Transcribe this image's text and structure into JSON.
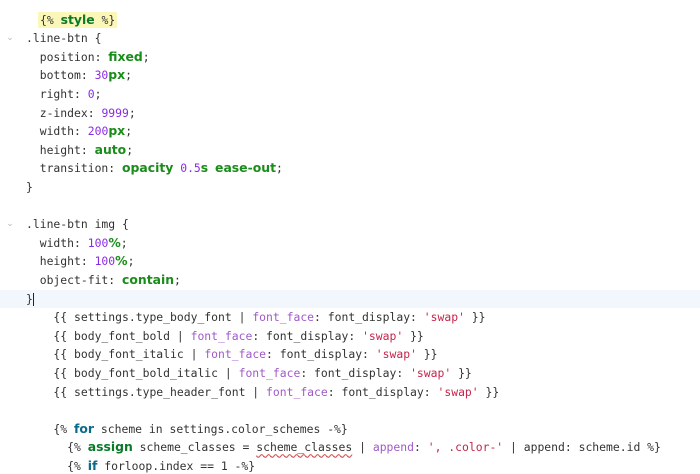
{
  "colors": {
    "background": "#ffffff",
    "active_line": "#f1f7fd",
    "value_green": "#1a8c1a",
    "number_purple": "#8a2be2",
    "string_red": "#c4254a",
    "filter_purple": "#a05ac8",
    "keyword_blue": "#0a6a8a",
    "style_highlight": "#fbf7b8"
  },
  "lines": [
    {
      "fold": "",
      "tokens": [
        {
          "t": "{% ",
          "c": "k-liquid-tag hl"
        },
        {
          "t": "style",
          "c": "k-liquid-kw2 hl"
        },
        {
          "t": " %}",
          "c": "k-liquid-tag hl"
        }
      ]
    },
    {
      "fold": "⌄",
      "tokens": [
        {
          "t": ".line-btn {",
          "c": "k-sel"
        }
      ]
    },
    {
      "fold": "",
      "tokens": [
        {
          "t": "  position: ",
          "c": "k-prop"
        },
        {
          "t": "fixed",
          "c": "k-val"
        },
        {
          "t": ";",
          "c": "k-punct"
        }
      ]
    },
    {
      "fold": "",
      "tokens": [
        {
          "t": "  bottom: ",
          "c": "k-prop"
        },
        {
          "t": "30",
          "c": "k-num"
        },
        {
          "t": "px",
          "c": "k-unit"
        },
        {
          "t": ";",
          "c": "k-punct"
        }
      ]
    },
    {
      "fold": "",
      "tokens": [
        {
          "t": "  right: ",
          "c": "k-prop"
        },
        {
          "t": "0",
          "c": "k-num"
        },
        {
          "t": ";",
          "c": "k-punct"
        }
      ]
    },
    {
      "fold": "",
      "tokens": [
        {
          "t": "  z-index: ",
          "c": "k-prop"
        },
        {
          "t": "9999",
          "c": "k-num"
        },
        {
          "t": ";",
          "c": "k-punct"
        }
      ]
    },
    {
      "fold": "",
      "tokens": [
        {
          "t": "  width: ",
          "c": "k-prop"
        },
        {
          "t": "200",
          "c": "k-num"
        },
        {
          "t": "px",
          "c": "k-unit"
        },
        {
          "t": ";",
          "c": "k-punct"
        }
      ]
    },
    {
      "fold": "",
      "tokens": [
        {
          "t": "  height: ",
          "c": "k-prop"
        },
        {
          "t": "auto",
          "c": "k-val"
        },
        {
          "t": ";",
          "c": "k-punct"
        }
      ]
    },
    {
      "fold": "",
      "tokens": [
        {
          "t": "  transition: ",
          "c": "k-prop"
        },
        {
          "t": "opacity",
          "c": "k-val"
        },
        {
          "t": " ",
          "c": "k-punct"
        },
        {
          "t": "0.5",
          "c": "k-num"
        },
        {
          "t": "s",
          "c": "k-unit"
        },
        {
          "t": " ",
          "c": "k-punct"
        },
        {
          "t": "ease-out",
          "c": "k-val"
        },
        {
          "t": ";",
          "c": "k-punct"
        }
      ]
    },
    {
      "fold": "",
      "tokens": [
        {
          "t": "}",
          "c": "k-punct"
        }
      ]
    },
    {
      "fold": "",
      "tokens": []
    },
    {
      "fold": "⌄",
      "tokens": [
        {
          "t": ".line-btn img {",
          "c": "k-sel"
        }
      ]
    },
    {
      "fold": "",
      "tokens": [
        {
          "t": "  width: ",
          "c": "k-prop"
        },
        {
          "t": "100",
          "c": "k-num"
        },
        {
          "t": "%",
          "c": "k-unit"
        },
        {
          "t": ";",
          "c": "k-punct"
        }
      ]
    },
    {
      "fold": "",
      "tokens": [
        {
          "t": "  height: ",
          "c": "k-prop"
        },
        {
          "t": "100",
          "c": "k-num"
        },
        {
          "t": "%",
          "c": "k-unit"
        },
        {
          "t": ";",
          "c": "k-punct"
        }
      ]
    },
    {
      "fold": "",
      "tokens": [
        {
          "t": "  object-fit: ",
          "c": "k-prop"
        },
        {
          "t": "contain",
          "c": "k-val"
        },
        {
          "t": ";",
          "c": "k-punct"
        }
      ]
    },
    {
      "fold": "",
      "active": true,
      "tokens": [
        {
          "t": "}",
          "c": "k-punct caret-after"
        }
      ]
    },
    {
      "fold": "",
      "tokens": [
        {
          "t": "    {{ settings.type_body_font | ",
          "c": "k-var"
        },
        {
          "t": "font_face",
          "c": "k-filter"
        },
        {
          "t": ": font_display: ",
          "c": "k-var"
        },
        {
          "t": "'swap'",
          "c": "k-str"
        },
        {
          "t": " }}",
          "c": "k-var"
        }
      ]
    },
    {
      "fold": "",
      "tokens": [
        {
          "t": "    {{ body_font_bold | ",
          "c": "k-var"
        },
        {
          "t": "font_face",
          "c": "k-filter"
        },
        {
          "t": ": font_display: ",
          "c": "k-var"
        },
        {
          "t": "'swap'",
          "c": "k-str"
        },
        {
          "t": " }}",
          "c": "k-var"
        }
      ]
    },
    {
      "fold": "",
      "tokens": [
        {
          "t": "    {{ body_font_italic | ",
          "c": "k-var"
        },
        {
          "t": "font_face",
          "c": "k-filter"
        },
        {
          "t": ": font_display: ",
          "c": "k-var"
        },
        {
          "t": "'swap'",
          "c": "k-str"
        },
        {
          "t": " }}",
          "c": "k-var"
        }
      ]
    },
    {
      "fold": "",
      "tokens": [
        {
          "t": "    {{ body_font_bold_italic | ",
          "c": "k-var"
        },
        {
          "t": "font_face",
          "c": "k-filter"
        },
        {
          "t": ": font_display: ",
          "c": "k-var"
        },
        {
          "t": "'swap'",
          "c": "k-str"
        },
        {
          "t": " }}",
          "c": "k-var"
        }
      ]
    },
    {
      "fold": "",
      "tokens": [
        {
          "t": "    {{ settings.type_header_font | ",
          "c": "k-var"
        },
        {
          "t": "font_face",
          "c": "k-filter"
        },
        {
          "t": ": font_display: ",
          "c": "k-var"
        },
        {
          "t": "'swap'",
          "c": "k-str"
        },
        {
          "t": " }}",
          "c": "k-var"
        }
      ]
    },
    {
      "fold": "",
      "tokens": []
    },
    {
      "fold": "",
      "tokens": [
        {
          "t": "    {% ",
          "c": "k-liquid-tag"
        },
        {
          "t": "for",
          "c": "k-liquid-kw"
        },
        {
          "t": " scheme in settings.color_schemes -%}",
          "c": "k-var"
        }
      ]
    },
    {
      "fold": "",
      "tokens": [
        {
          "t": "      {% ",
          "c": "k-liquid-tag"
        },
        {
          "t": "assign",
          "c": "k-liquid-kw2"
        },
        {
          "t": " scheme_classes = ",
          "c": "k-var"
        },
        {
          "t": "scheme_classes",
          "c": "k-var k-sq"
        },
        {
          "t": " | ",
          "c": "k-var"
        },
        {
          "t": "append",
          "c": "k-filter"
        },
        {
          "t": ": ",
          "c": "k-var"
        },
        {
          "t": "', .color-'",
          "c": "k-str"
        },
        {
          "t": " | append: scheme.id %}",
          "c": "k-var"
        }
      ]
    },
    {
      "fold": "",
      "tokens": [
        {
          "t": "      {% ",
          "c": "k-liquid-tag"
        },
        {
          "t": "if",
          "c": "k-liquid-kw"
        },
        {
          "t": " forloop.index == 1 -%}",
          "c": "k-var"
        }
      ]
    }
  ]
}
